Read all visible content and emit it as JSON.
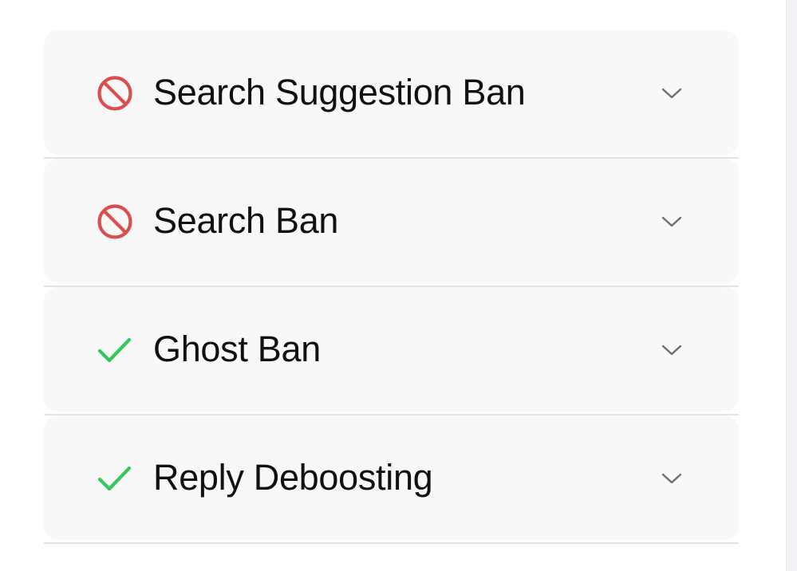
{
  "colors": {
    "banned": "#dc4e4e",
    "clear": "#34c759",
    "chevron": "#6e6e73"
  },
  "checks": [
    {
      "label": "Search Suggestion Ban",
      "status": "banned",
      "icon": "prohibited-icon"
    },
    {
      "label": "Search Ban",
      "status": "banned",
      "icon": "prohibited-icon"
    },
    {
      "label": "Ghost Ban",
      "status": "clear",
      "icon": "checkmark-icon"
    },
    {
      "label": "Reply Deboosting",
      "status": "clear",
      "icon": "checkmark-icon"
    }
  ]
}
